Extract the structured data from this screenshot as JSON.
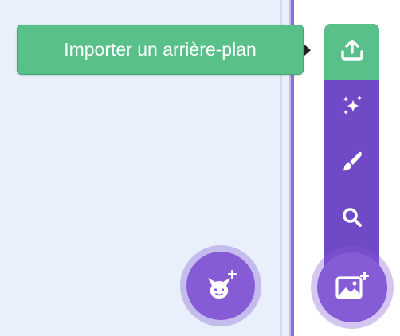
{
  "tooltip": {
    "text": "Importer un arrière-plan"
  },
  "backdrop_menu": {
    "items": [
      {
        "icon": "upload-icon"
      },
      {
        "icon": "surprise-sparkle-icon"
      },
      {
        "icon": "paint-brush-icon"
      },
      {
        "icon": "search-icon"
      }
    ]
  },
  "buttons": {
    "sprite": {
      "icon": "cat-add-icon"
    },
    "backdrop": {
      "icon": "image-add-icon"
    }
  },
  "colors": {
    "stage_bg": "#e9f0fb",
    "accent_purple": "#855cd6",
    "menu_purple": "#7049c6",
    "active_green": "#59c08a",
    "white": "#ffffff"
  }
}
